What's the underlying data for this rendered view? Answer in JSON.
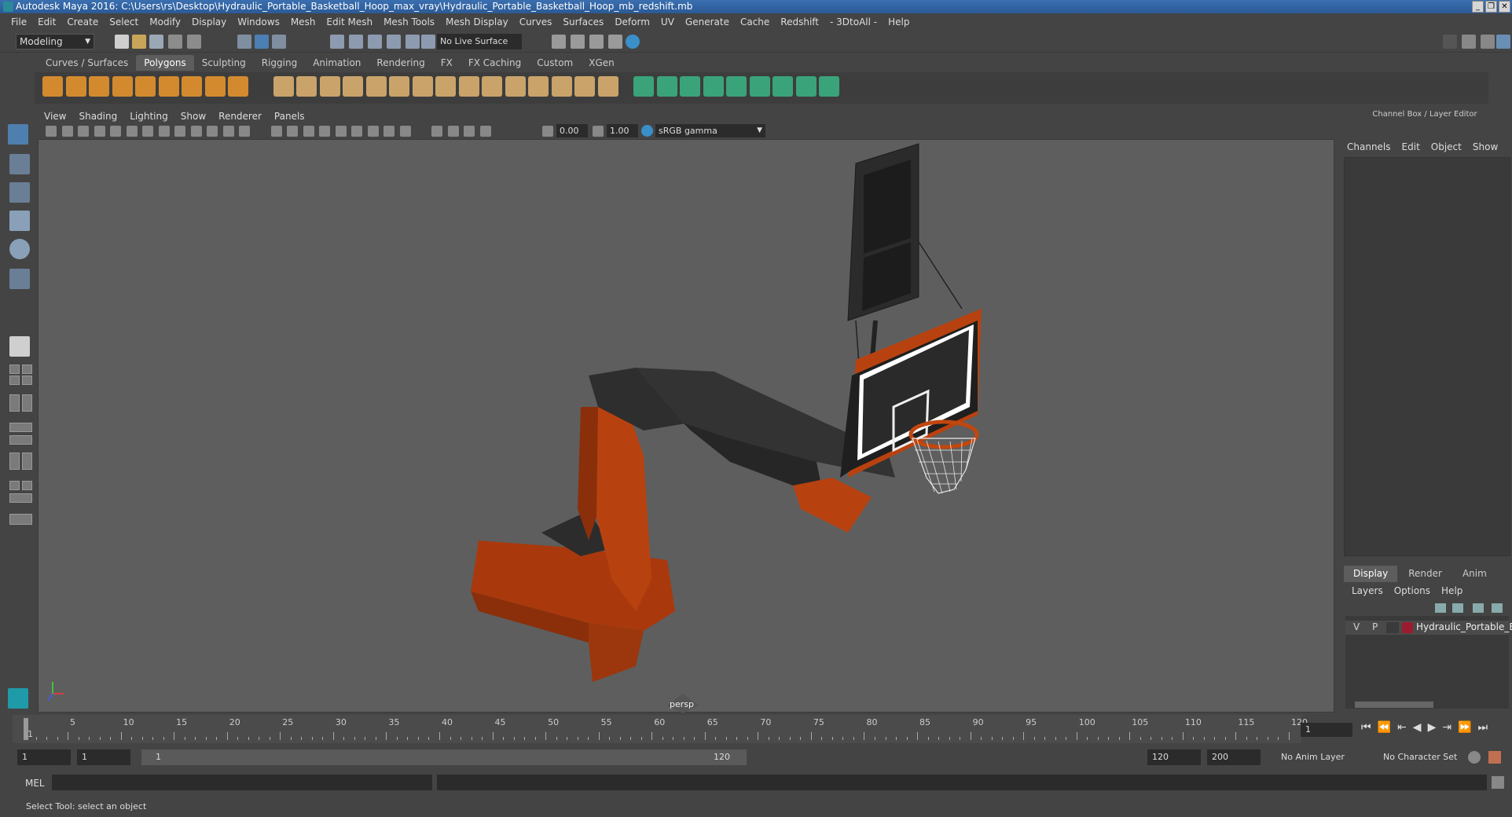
{
  "window": {
    "title": "Autodesk Maya 2016: C:\\Users\\rs\\Desktop\\Hydraulic_Portable_Basketball_Hoop_max_vray\\Hydraulic_Portable_Basketball_Hoop_mb_redshift.mb"
  },
  "menubar": [
    "File",
    "Edit",
    "Create",
    "Select",
    "Modify",
    "Display",
    "Windows",
    "Mesh",
    "Edit Mesh",
    "Mesh Tools",
    "Mesh Display",
    "Curves",
    "Surfaces",
    "Deform",
    "UV",
    "Generate",
    "Cache",
    "Redshift",
    "- 3DtoAll -",
    "Help"
  ],
  "toolbar": {
    "mode": "Modeling",
    "live_surface": "No Live Surface"
  },
  "shelf_tabs": [
    "Curves / Surfaces",
    "Polygons",
    "Sculpting",
    "Rigging",
    "Animation",
    "Rendering",
    "FX",
    "FX Caching",
    "Custom",
    "XGen"
  ],
  "shelf_active": "Polygons",
  "viewport": {
    "menu": [
      "View",
      "Shading",
      "Lighting",
      "Show",
      "Renderer",
      "Panels"
    ],
    "exposure": "0.00",
    "gamma": "1.00",
    "color_space": "sRGB gamma",
    "camera": "persp"
  },
  "channel_box": {
    "title": "Channel Box / Layer Editor",
    "menu": [
      "Channels",
      "Edit",
      "Object",
      "Show"
    ]
  },
  "layer_editor": {
    "tabs": [
      "Display",
      "Render",
      "Anim"
    ],
    "active_tab": "Display",
    "menu": [
      "Layers",
      "Options",
      "Help"
    ],
    "layers": [
      {
        "v": "V",
        "p": "P",
        "name": "Hydraulic_Portable_Ba",
        "color": "#9b1b30"
      }
    ]
  },
  "timeline": {
    "ticks": [
      "1",
      "5",
      "10",
      "15",
      "20",
      "25",
      "30",
      "35",
      "40",
      "45",
      "50",
      "55",
      "60",
      "65",
      "70",
      "75",
      "80",
      "85",
      "90",
      "95",
      "100",
      "105",
      "110",
      "115",
      "120"
    ],
    "current_frame": "1"
  },
  "range": {
    "start": "1",
    "playback_start": "1",
    "slider_start": "1",
    "slider_end": "120",
    "playback_end": "120",
    "end": "200",
    "anim_layer": "No Anim Layer",
    "char_set": "No Character Set"
  },
  "command": {
    "label": "MEL"
  },
  "helpline": "Select Tool: select an object",
  "colors": {
    "orange": "#b8420f",
    "dark_metal": "#2e2e2e",
    "viewport_bg": "#5e5e5e"
  }
}
